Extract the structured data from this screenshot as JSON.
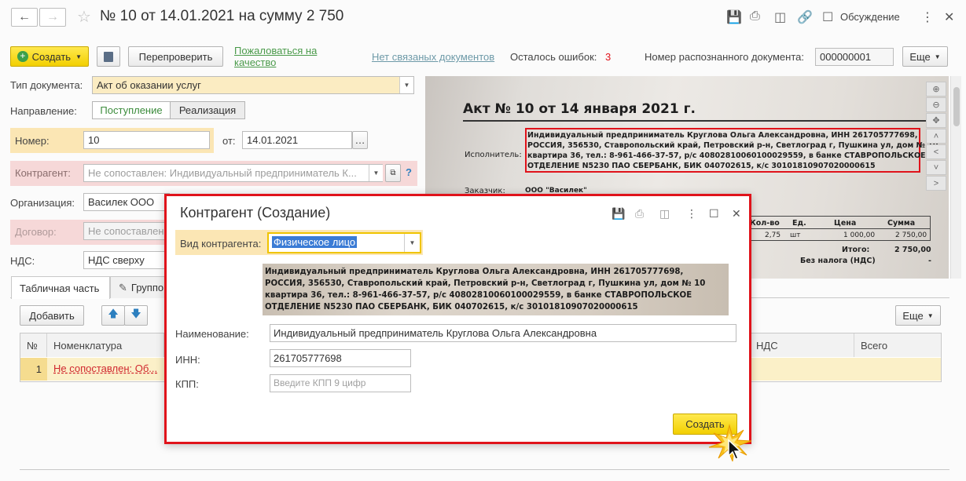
{
  "window": {
    "title": "№ 10 от 14.01.2021 на сумму 2 750",
    "back_glyph": "🡐",
    "forward_glyph": "🡒",
    "discuss_label": "Обсуждение"
  },
  "toolbar": {
    "create_label": "Создать",
    "recheck_label": "Перепроверить",
    "complain_label_line1": "Пожаловаться на",
    "complain_label_line2": "качество",
    "no_linked_docs": "Нет связаных документов",
    "errors_left_label": "Осталось ошибок:",
    "errors_left_value": "3",
    "recognized_doc_label": "Номер распознанного документа:",
    "recognized_doc_value": "000000001",
    "more_label": "Еще"
  },
  "form": {
    "doc_type_label": "Тип документа:",
    "doc_type_value": "Акт об оказании услуг",
    "direction_label": "Направление:",
    "direction_options": [
      "Поступление",
      "Реализация"
    ],
    "number_label": "Номер:",
    "number_value": "10",
    "date_label": "от:",
    "date_value": "14.01.2021",
    "counterparty_label": "Контрагент:",
    "counterparty_value": "Не сопоставлен: Индивидуальный предприниматель К...",
    "organization_label": "Организация:",
    "organization_value": "Василек ООО",
    "contract_label": "Договор:",
    "contract_value": "Не сопоставлен",
    "vat_label": "НДС:",
    "vat_value": "НДС сверху"
  },
  "tabs": {
    "table_part": "Табличная часть",
    "groups": "Группо"
  },
  "table": {
    "add_label": "Добавить",
    "more_label": "Еще",
    "columns": [
      "№",
      "Номенклатура",
      "НДС",
      "Всего"
    ],
    "rows": [
      {
        "num": "1",
        "item": "Не сопоставлен: Об..."
      }
    ]
  },
  "scan": {
    "heading": "Акт № 10 от 14 января 2021 г.",
    "executor_label": "Исполнитель:",
    "customer_label": "Заказчик:",
    "customer_value": "ООО \"Василек\"",
    "executor_text_lines": [
      "Индивидуальный предприниматель Круглова Ольга Александровна, ИНН 261705777698,",
      "РОССИЯ, 356530, Ставропольский край, Петровский р-н, Светлоград г, Пушкина ул, дом № 10",
      "квартира 36, тел.: 8-961-466-37-57, р/с 40802810060100029559, в банке СТАВРОПОЛЬСКОЕ",
      "ОТДЕЛЕНИЕ N5230 ПАО СБЕРБАНК, БИК 040702615, к/с 30101810907020000615"
    ],
    "table_headers": [
      "Кол-во",
      "Ед.",
      "Цена",
      "Сумма"
    ],
    "table_row": [
      "2,75",
      "шт",
      "1 000,00",
      "2 750,00"
    ],
    "total_label": "Итого:",
    "total_value": "2 750,00",
    "no_vat_label": "Без налога (НДС)",
    "no_vat_value": "-"
  },
  "modal": {
    "title": "Контрагент (Создание)",
    "kind_label": "Вид контрагента:",
    "kind_value": "Физическое лицо",
    "snippet_lines": [
      "Индивидуальный предприниматель Круглова Ольга Александровна, ИНН 261705777698,",
      "РОССИЯ, 356530, Ставропольский край, Петровский р-н, Светлоград г, Пушкина ул, дом № 10",
      "квартира 36, тел.: 8-961-466-37-57, р/с 40802810060100029559, в банке СТАВРОПОЛЬСКОЕ",
      "ОТДЕЛЕНИЕ N5230 ПАО СБЕРБАНК, БИК 040702615, к/с 30101810907020000615"
    ],
    "name_label": "Наименование:",
    "name_value": "Индивидуальный предприниматель Круглова Ольга Александровна",
    "inn_label": "ИНН:",
    "inn_value": "261705777698",
    "kpp_label": "КПП:",
    "kpp_placeholder": "Введите КПП 9 цифр",
    "create_label": "Создать"
  },
  "colors": {
    "accent_yellow": "#f5d400",
    "error_red": "#e0131b",
    "link_green": "#4a9a4a",
    "highlight_row": "#fbe6b4",
    "error_row": "#f6d8d8"
  }
}
